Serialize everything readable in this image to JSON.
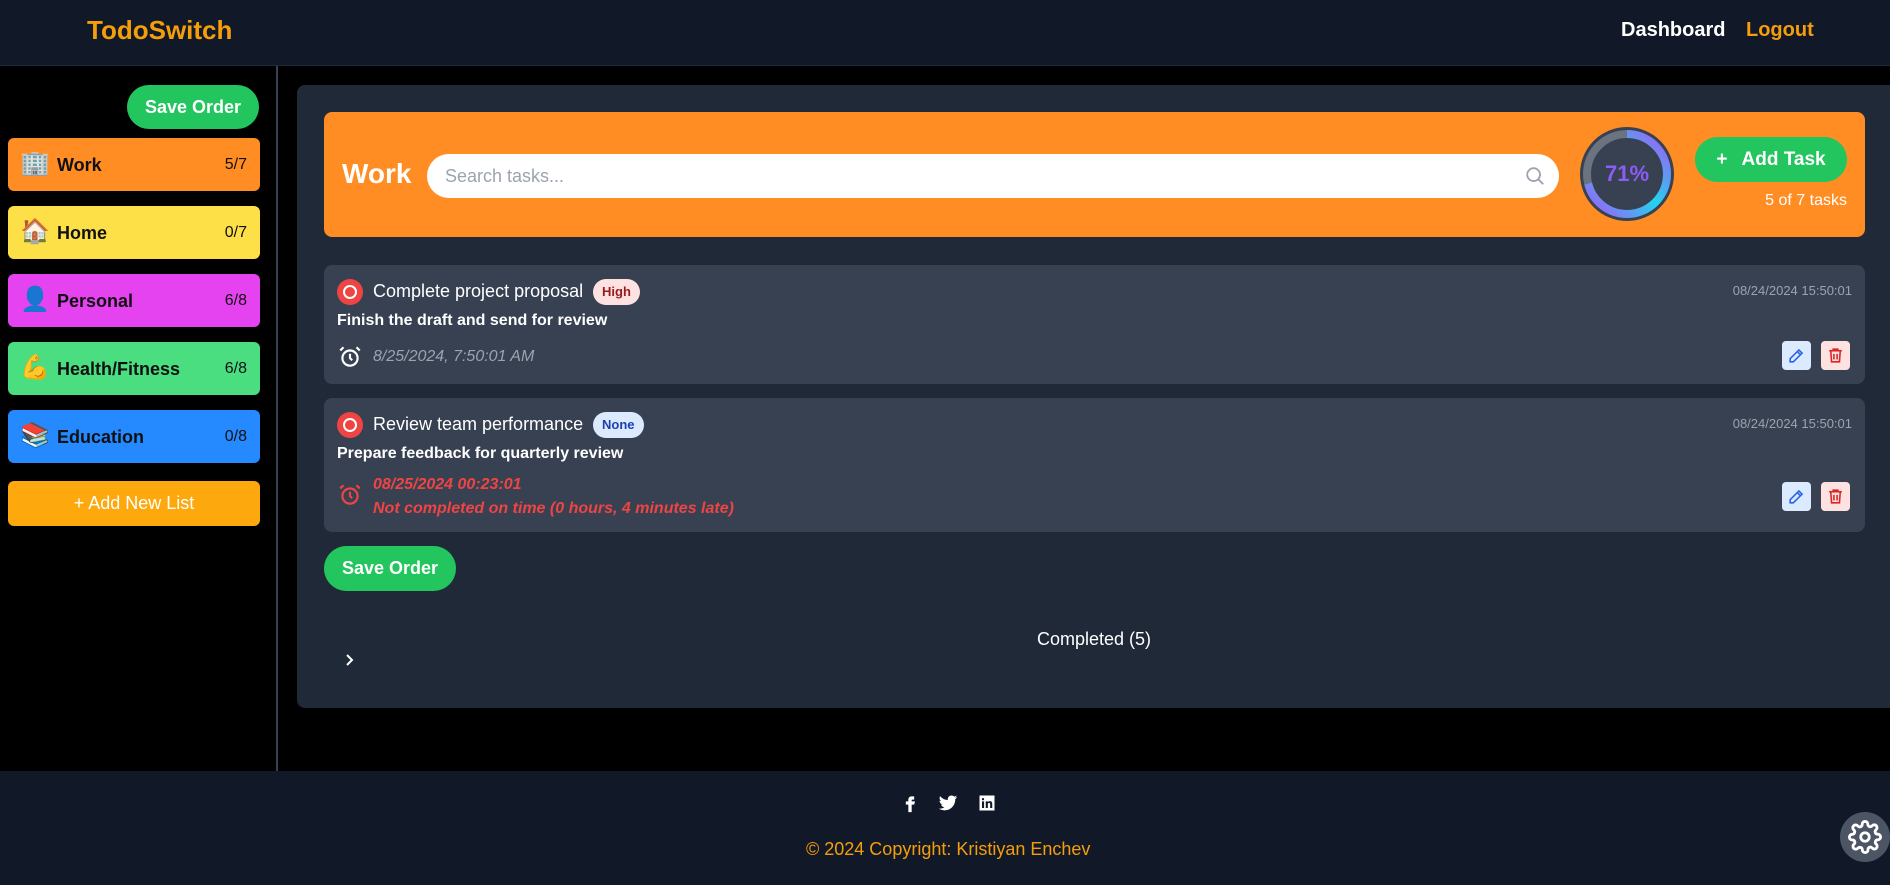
{
  "header": {
    "brand": "TodoSwitch",
    "nav": {
      "dashboard": "Dashboard",
      "logout": "Logout"
    }
  },
  "sidebar": {
    "save_order": "Save Order",
    "lists": [
      {
        "emoji": "🏢",
        "name": "Work",
        "count": "5/7",
        "color": "#ff8d23"
      },
      {
        "emoji": "🏠",
        "name": "Home",
        "count": "0/7",
        "color": "#fde047"
      },
      {
        "emoji": "👤",
        "name": "Personal",
        "count": "6/8",
        "color": "#e543f0"
      },
      {
        "emoji": "💪",
        "name": "Health/Fitness",
        "count": "6/8",
        "color": "#4ade80"
      },
      {
        "emoji": "📚",
        "name": "Education",
        "count": "0/8",
        "color": "#2589ff"
      }
    ],
    "add_list": "+  Add New List"
  },
  "main": {
    "list_title": "Work",
    "search_placeholder": "Search tasks...",
    "progress_percent": 71,
    "progress_label": "71%",
    "add_task": "Add Task",
    "tasks_count": "5 of 7 tasks",
    "tasks": [
      {
        "title": "Complete project proposal",
        "priority": "High",
        "created": "08/24/2024 15:50:01",
        "description": "Finish the draft and send for review",
        "due": "8/25/2024, 7:50:01 AM",
        "late_note": ""
      },
      {
        "title": "Review team performance",
        "priority": "None",
        "created": "08/24/2024 15:50:01",
        "description": "Prepare feedback for quarterly review",
        "due": "08/25/2024 00:23:01",
        "late_note": "Not completed on time (0 hours, 4 minutes late)"
      }
    ],
    "save_order": "Save Order",
    "completed_label": "Completed (5)"
  },
  "footer": {
    "copyright": "© 2024 Copyright:  Kristiyan Enchev",
    "social_icons": [
      "facebook-icon",
      "twitter-icon",
      "linkedin-icon"
    ]
  },
  "colors": {
    "accent": "#f59e0b",
    "green": "#22c55e",
    "danger": "#ef4444",
    "panel": "#1f2937",
    "card": "#374151"
  }
}
